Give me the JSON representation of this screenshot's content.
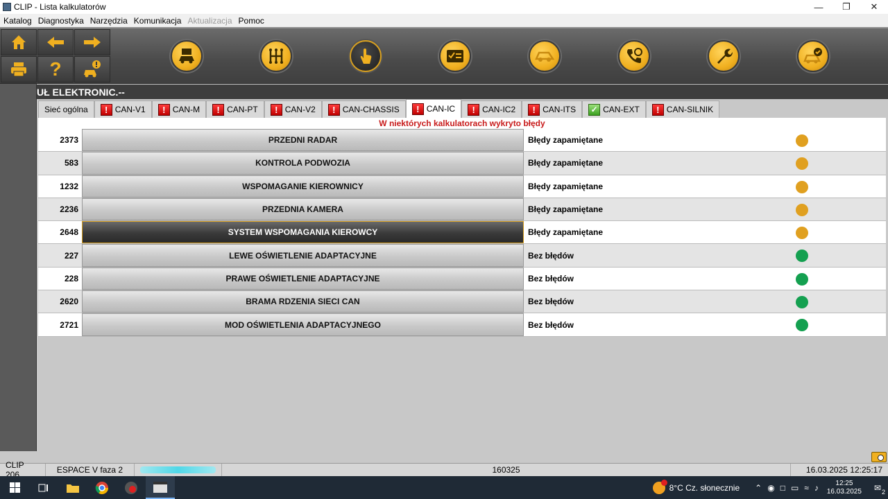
{
  "window": {
    "title": "CLIP - Lista kalkulatorów"
  },
  "menu": [
    "Katalog",
    "Diagnostyka",
    "Narzędzia",
    "Komunikacja",
    "Aktualizacja",
    "Pomoc"
  ],
  "menu_disabled": [
    "Aktualizacja"
  ],
  "toolbar": {
    "small_buttons": [
      {
        "icon": "home-icon"
      },
      {
        "icon": "arrow-left-icon"
      },
      {
        "icon": "arrow-right-icon"
      },
      {
        "icon": "printer-icon"
      },
      {
        "icon": "help-icon"
      },
      {
        "icon": "car-alert-icon"
      }
    ],
    "big_buttons": [
      {
        "icon": "vehicle-info-icon"
      },
      {
        "icon": "gearbox-icon"
      },
      {
        "icon": "touch-icon",
        "active": true
      },
      {
        "icon": "checklist-icon"
      },
      {
        "icon": "car-diagnostic-icon"
      },
      {
        "icon": "phone-support-icon"
      },
      {
        "icon": "wrench-icon"
      },
      {
        "icon": "car-check-icon"
      }
    ]
  },
  "header": {
    "title": "UŁ ELEKTRONIC.--"
  },
  "tabs": [
    {
      "label": "Sieć ogólna",
      "flag": ""
    },
    {
      "label": "CAN-V1",
      "flag": "error"
    },
    {
      "label": "CAN-M",
      "flag": "error"
    },
    {
      "label": "CAN-PT",
      "flag": "error"
    },
    {
      "label": "CAN-V2",
      "flag": "error"
    },
    {
      "label": "CAN-CHASSIS",
      "flag": "error"
    },
    {
      "label": "CAN-IC",
      "flag": "error",
      "active": true
    },
    {
      "label": "CAN-IC2",
      "flag": "error"
    },
    {
      "label": "CAN-ITS",
      "flag": "error"
    },
    {
      "label": "CAN-EXT",
      "flag": "ok"
    },
    {
      "label": "CAN-SILNIK",
      "flag": "error"
    }
  ],
  "warning_text": "W niektórych kalkulatorach wykryto błędy",
  "rows": [
    {
      "num": "2373",
      "name": "PRZEDNI RADAR",
      "status": "Błędy zapamiętane",
      "state": "orange"
    },
    {
      "num": "583",
      "name": "KONTROLA PODWOZIA",
      "status": "Błędy zapamiętane",
      "state": "orange"
    },
    {
      "num": "1232",
      "name": "WSPOMAGANIE KIEROWNICY",
      "status": "Błędy zapamiętane",
      "state": "orange"
    },
    {
      "num": "2236",
      "name": "PRZEDNIA KAMERA",
      "status": "Błędy zapamiętane",
      "state": "orange"
    },
    {
      "num": "2648",
      "name": "SYSTEM WSPOMAGANIA KIEROWCY",
      "status": "Błędy zapamiętane",
      "state": "orange",
      "selected": true
    },
    {
      "num": "227",
      "name": "LEWE OŚWIETLENIE ADAPTACYJNE",
      "status": "Bez błędów",
      "state": "green"
    },
    {
      "num": "228",
      "name": "PRAWE OŚWIETLENIE ADAPTACYJNE",
      "status": "Bez błędów",
      "state": "green"
    },
    {
      "num": "2620",
      "name": "BRAMA RDZENIA SIECI CAN",
      "status": "Bez błędów",
      "state": "green"
    },
    {
      "num": "2721",
      "name": "MOD OŚWIETLENIA ADAPTACYJNEGO",
      "status": "Bez błędów",
      "state": "green"
    }
  ],
  "statusbar": {
    "clip": "CLIP 206",
    "vehicle": "ESPACE V faza 2",
    "vin_redacted": "",
    "code": "160325",
    "datetime": "16.03.2025 12:25:17"
  },
  "taskbar": {
    "weather": "8°C  Cz. słonecznie",
    "time": "12:25",
    "date": "16.03.2025",
    "notification_count": "2"
  },
  "colors": {
    "accent": "#f0b020",
    "error": "#c00000",
    "ok": "#14a050",
    "warning_text": "#c81a1a"
  }
}
